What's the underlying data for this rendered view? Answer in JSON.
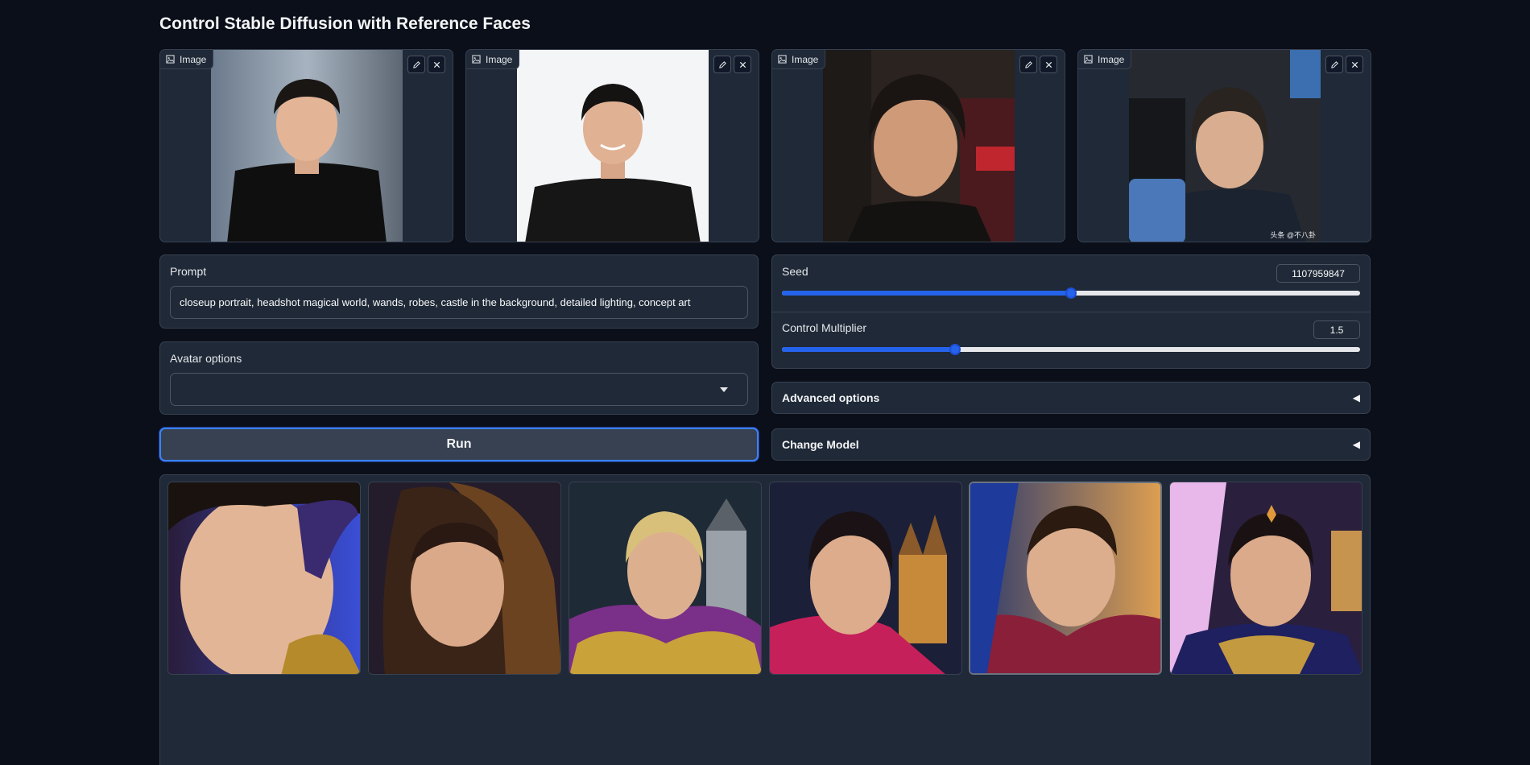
{
  "page": {
    "title": "Control Stable Diffusion with Reference Faces"
  },
  "reference_images": [
    {
      "label": "Image",
      "watermark": ""
    },
    {
      "label": "Image",
      "watermark": ""
    },
    {
      "label": "Image",
      "watermark": ""
    },
    {
      "label": "Image",
      "watermark": "头条 @不八卦"
    }
  ],
  "prompt": {
    "label": "Prompt",
    "value": "closeup portrait, headshot magical world, wands, robes, castle in the background, detailed lighting, concept art"
  },
  "avatar_options": {
    "label": "Avatar options",
    "value": ""
  },
  "seed": {
    "label": "Seed",
    "value": "1107959847",
    "fraction": 0.5
  },
  "control_multiplier": {
    "label": "Control Multiplier",
    "value": "1.5",
    "fraction": 0.3
  },
  "advanced_options": {
    "label": "Advanced options",
    "icon": "◀"
  },
  "change_model": {
    "label": "Change Model",
    "icon": "◀"
  },
  "run": {
    "label": "Run"
  },
  "gallery": {
    "count": 6,
    "selected_index": 4
  },
  "colors": {
    "accent": "#2563eb",
    "panel": "#1f2937",
    "background": "#0b0f19"
  }
}
